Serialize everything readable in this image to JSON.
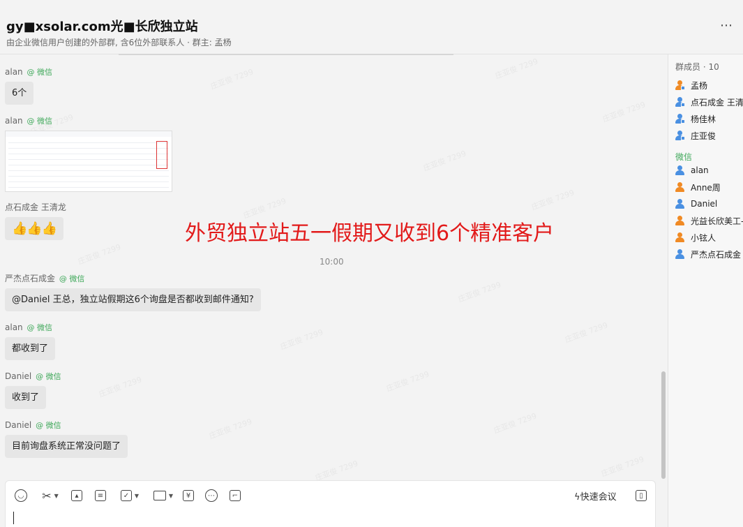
{
  "header": {
    "title": "gy■xsolar.com光■长欣独立站",
    "subtitle": "由企业微信用户创建的外部群, 含6位外部联系人 · 群主: 孟杨",
    "more_icon": "more-horizontal-icon"
  },
  "messages": [
    {
      "sender": "alan",
      "tag": "@ 微信",
      "text": "6个"
    },
    {
      "sender": "alan",
      "tag": "@ 微信",
      "image": "spreadsheet-screenshot"
    },
    {
      "sender": "点石成金 王清龙",
      "tag": "",
      "text": "👍👍👍"
    },
    {
      "sender": "严杰点石成金",
      "tag": "@ 微信",
      "text": "@Daniel  王总，独立站假期这6个询盘是否都收到邮件通知?"
    },
    {
      "sender": "alan",
      "tag": "@ 微信",
      "text": "都收到了"
    },
    {
      "sender": "Daniel",
      "tag": "@ 微信",
      "text": "收到了"
    },
    {
      "sender": "Daniel",
      "tag": "@ 微信",
      "text": "目前询盘系统正常没问题了"
    }
  ],
  "banner": "外贸独立站五一假期又收到6个精准客户",
  "time_divider": "10:00",
  "watermark": "庄亚俊 7299",
  "sidebar": {
    "title": "群成员 · 10",
    "internal_members": [
      "孟杨",
      "点石成金 王清",
      "杨佳林",
      "庄亚俊"
    ],
    "wechat_group_label": "微信",
    "wechat_members": [
      {
        "name": "alan",
        "color": "#4a90e2"
      },
      {
        "name": "Anne周",
        "color": "#f08a24"
      },
      {
        "name": "Daniel",
        "color": "#4a90e2"
      },
      {
        "name": "光益长欣美工-",
        "color": "#f08a24"
      },
      {
        "name": "小铉人",
        "color": "#f08a24"
      },
      {
        "name": "严杰点石成金",
        "color": "#4a90e2"
      }
    ]
  },
  "composer": {
    "tools": [
      "emoji-icon",
      "scissors-icon",
      "image-icon",
      "document-icon",
      "task-icon",
      "folder-icon",
      "yen-icon",
      "more-circle-icon",
      "screen-icon"
    ],
    "quick_meeting": "快速会议",
    "side_panel_icon": "sidebar-toggle-icon"
  },
  "colors": {
    "wechat_tag": "#3fa85a",
    "banner": "#e21a1a",
    "member_blue": "#4a90e2",
    "member_orange": "#f08a24"
  }
}
